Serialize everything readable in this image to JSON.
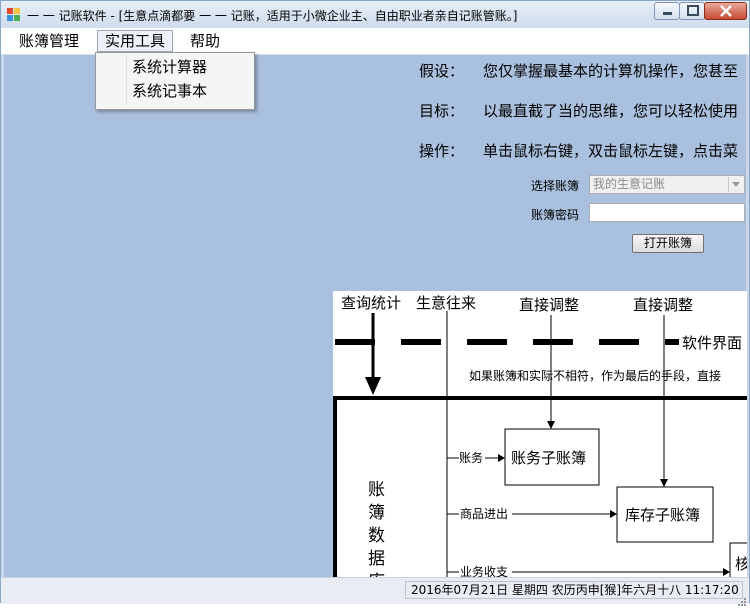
{
  "window": {
    "title": "一 一 记账软件 - [生意点滴都要 一 一 记账，适用于小微企业主、自由职业者亲自记账管账。]"
  },
  "menu": {
    "items": [
      "账簿管理",
      "实用工具",
      "帮助"
    ],
    "open_submenu": [
      "系统计算器",
      "系统记事本"
    ]
  },
  "info": [
    {
      "label": "假设：",
      "text": "您仅掌握最基本的计算机操作，您甚至"
    },
    {
      "label": "目标：",
      "text": "以最直截了当的思维，您可以轻松使用"
    },
    {
      "label": "操作：",
      "text": "单击鼠标右键，双击鼠标左键，点击菜"
    }
  ],
  "form": {
    "book_label": "选择账簿",
    "book_value": "我的生意记账",
    "password_label": "账簿密码",
    "password_value": "",
    "open_button": "打开账簿"
  },
  "diagram": {
    "top_labels": [
      "查询统计",
      "生意往来",
      "直接调整",
      "直接调整"
    ],
    "interface_label": "软件界面",
    "note": "如果账簿和实际不相符，作为最后的手段，直接",
    "database_label": "账簿数据库",
    "branch_labels": [
      "账务",
      "商品进出",
      "业务收支"
    ],
    "box_account": "账务子账簿",
    "box_inventory": "库存子账簿",
    "partial_char": "核"
  },
  "status": {
    "datetime": "2016年07月21日 星期四 农历丙申[猴]年六月十八 11:17:20"
  },
  "colors": {
    "client_bg": "#a9c0de",
    "title_bg": "#dbe6f4",
    "close_button": "#c64a32"
  }
}
